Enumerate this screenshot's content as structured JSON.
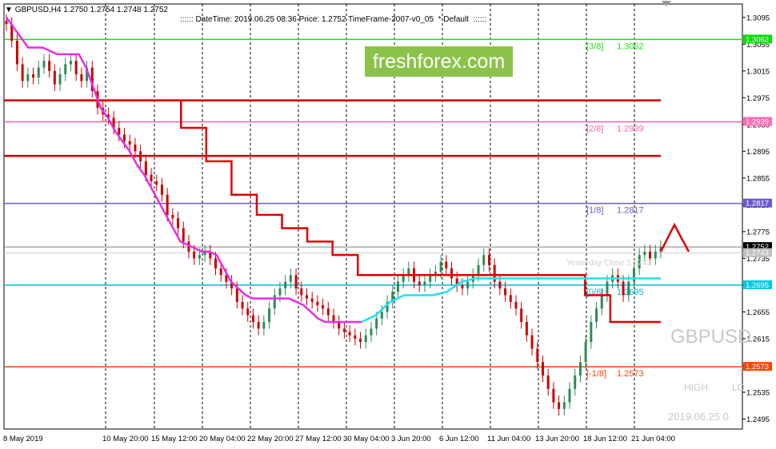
{
  "header": {
    "symbol_line": "GBPUSD,H4  1.2750 1.2754 1.2748 1.2752",
    "info_line": "DateTime: 2019.06.25 08:36    Price: 1.2752    TimeFrame-2007-v0_05",
    "profile": "Default"
  },
  "watermark": "freshforex.com",
  "overlay": {
    "symbol_big": "GBPUSD",
    "high_label": "HIGH",
    "low_label": "LO",
    "date_label": "2019.06.25 0",
    "yesterday_close": "Yesterday Close 1.2743"
  },
  "colors": {
    "bull_candle": "#2e8b57",
    "bear_candle": "#cc0000",
    "magenta_line": "#e62ee6",
    "cyan_line": "#22e0f0",
    "red_line": "#e00000",
    "arrow": "#e00000"
  },
  "chart_data": {
    "type": "candlestick",
    "symbol": "GBPUSD",
    "timeframe": "H4",
    "ylim": [
      1.248,
      1.3115
    ],
    "y_ticks": [
      "1.3095",
      "1.3055",
      "1.3015",
      "1.2975",
      "1.2935",
      "1.2895",
      "1.2855",
      "1.2815",
      "1.2775",
      "1.2735",
      "1.2695",
      "1.2655",
      "1.2615",
      "1.2575",
      "1.2535",
      "1.2495"
    ],
    "x_ticks": [
      "8 May 2019",
      "10 May 20:00",
      "15 May 12:00",
      "20 May 04:00",
      "22 May 20:00",
      "27 May 12:00",
      "30 May 04:00",
      "3 Jun 20:00",
      "6 Jun 12:00",
      "11 Jun 04:00",
      "13 Jun 20:00",
      "18 Jun 12:00",
      "21 Jun 04:00"
    ],
    "price_labels": [
      {
        "value": 1.3062,
        "text": "1.3062",
        "color": "#00e000"
      },
      {
        "value": 1.2939,
        "text": "1.2939",
        "color": "#ff69b4"
      },
      {
        "value": 1.2817,
        "text": "1.2817",
        "color": "#6a5acd"
      },
      {
        "value": 1.2752,
        "text": "1.2752",
        "color": "#000000"
      },
      {
        "value": 1.2743,
        "text": "1.2743",
        "color": "#c0c0c0"
      },
      {
        "value": 1.2695,
        "text": "1.2695",
        "color": "#00c8e6"
      },
      {
        "value": 1.2573,
        "text": "1.2573",
        "color": "#ff4500"
      }
    ],
    "levels": [
      {
        "label": "[3/8]",
        "value": 1.3062,
        "text": "1.3062",
        "color": "#22dd22"
      },
      {
        "label": "[2/8]",
        "value": 1.2939,
        "text": "1.2939",
        "color": "#ee66aa"
      },
      {
        "label": "[1/8]",
        "value": 1.2817,
        "text": "1.2817",
        "color": "#6a5acd"
      },
      {
        "label": "[0/8]",
        "value": 1.2695,
        "text": "1.2695",
        "color": "#00bcd4"
      },
      {
        "label": "[-1/8]",
        "value": 1.2573,
        "text": "1.2573",
        "color": "#ff4500"
      }
    ],
    "horizontal_lines": [
      {
        "value": 1.2971,
        "color": "#cc0000"
      },
      {
        "value": 1.2888,
        "color": "#cc0000"
      }
    ],
    "closes": [
      1.3085,
      1.306,
      1.3025,
      1.3,
      1.301,
      1.3005,
      1.302,
      1.303,
      1.3015,
      1.2995,
      1.301,
      1.3025,
      1.303,
      1.301,
      1.3,
      1.302,
      1.2985,
      1.296,
      1.295,
      1.2945,
      1.293,
      1.292,
      1.291,
      1.2905,
      1.2895,
      1.288,
      1.286,
      1.285,
      1.2845,
      1.283,
      1.28,
      1.2795,
      1.278,
      1.276,
      1.2745,
      1.2735,
      1.274,
      1.2745,
      1.2735,
      1.272,
      1.271,
      1.27,
      1.269,
      1.267,
      1.266,
      1.265,
      1.264,
      1.263,
      1.264,
      1.266,
      1.268,
      1.269,
      1.27,
      1.271,
      1.269,
      1.268,
      1.2675,
      1.267,
      1.2665,
      1.266,
      1.265,
      1.264,
      1.263,
      1.2625,
      1.262,
      1.2615,
      1.261,
      1.262,
      1.263,
      1.2645,
      1.2655,
      1.267,
      1.2685,
      1.27,
      1.271,
      1.272,
      1.27,
      1.2695,
      1.27,
      1.271,
      1.2715,
      1.273,
      1.272,
      1.2705,
      1.2695,
      1.269,
      1.27,
      1.271,
      1.2725,
      1.274,
      1.2725,
      1.27,
      1.269,
      1.268,
      1.267,
      1.266,
      1.264,
      1.262,
      1.26,
      1.258,
      1.256,
      1.254,
      1.252,
      1.251,
      1.252,
      1.254,
      1.256,
      1.258,
      1.261,
      1.264,
      1.266,
      1.268,
      1.27,
      1.271,
      1.27,
      1.268,
      1.27,
      1.272,
      1.274,
      1.2745,
      1.2735,
      1.2745,
      1.2752
    ],
    "magenta_line": [
      1.3095,
      1.308,
      1.3065,
      1.305,
      1.305,
      1.305,
      1.3045,
      1.304,
      1.304,
      1.304,
      1.304,
      1.302,
      1.299,
      1.296,
      1.2945,
      1.2925,
      1.291,
      1.2895,
      1.2875,
      1.286,
      1.284,
      1.282,
      1.28,
      1.278,
      1.276,
      1.2755,
      1.275,
      1.2745,
      1.2745,
      1.274,
      1.272,
      1.27,
      1.269,
      1.268,
      1.2675,
      1.2675,
      1.2675,
      1.2675,
      1.2675,
      1.2675,
      1.267,
      1.2665,
      1.2655,
      1.2645,
      1.264,
      1.264,
      1.264,
      1.264,
      1.264,
      1.264
    ],
    "cyan_line": [
      1.264,
      1.265,
      1.267,
      1.268,
      1.268,
      1.268,
      1.2685,
      1.27,
      1.2705,
      1.2705,
      1.2705,
      1.2705,
      1.2705,
      1.2705,
      1.2705,
      1.2705,
      1.2705,
      1.2705,
      1.2705,
      1.2705,
      1.2705,
      1.2705
    ],
    "red_step_line": [
      1.2971,
      1.2971,
      1.2971,
      1.2971,
      1.293,
      1.288,
      1.283,
      1.28,
      1.278,
      1.276,
      1.274,
      1.271,
      1.271,
      1.271,
      1.271,
      1.271,
      1.271,
      1.271,
      1.271,
      1.271,
      1.268,
      1.264,
      1.264,
      1.264
    ]
  }
}
